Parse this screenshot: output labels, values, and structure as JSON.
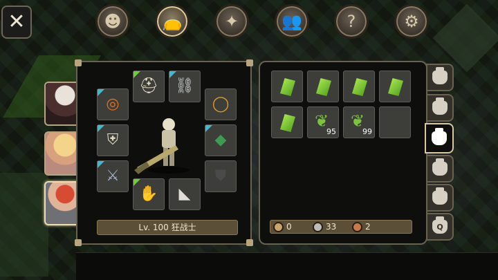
{
  "close_button": {
    "label": "✕",
    "icon": "close-icon"
  },
  "top_tabs": [
    {
      "icon": "profile-head-icon",
      "glyph": "☻",
      "active": false
    },
    {
      "icon": "bag-icon",
      "glyph": "👝",
      "active": true
    },
    {
      "icon": "skill-compass-icon",
      "glyph": "✦",
      "active": false
    },
    {
      "icon": "party-icon",
      "glyph": "👥",
      "active": false
    },
    {
      "icon": "quest-scroll-icon",
      "glyph": "?",
      "active": false
    },
    {
      "icon": "gear-icon",
      "glyph": "⚙",
      "active": false
    }
  ],
  "characters": [
    {
      "name": "white-hair-character",
      "active": false
    },
    {
      "name": "blonde-character",
      "active": false
    },
    {
      "name": "red-hair-armored-character",
      "active": true
    }
  ],
  "equipment": {
    "level_text": "Lv. 100 狂战士",
    "slots": [
      {
        "name": "necklace-slot",
        "icon": "necklace-icon",
        "glyph": "⛓",
        "rarity": "blue",
        "color": "#cfd4d6"
      },
      {
        "name": "helmet-slot",
        "icon": "helmet-icon",
        "glyph": "⛑",
        "rarity": "green",
        "color": "#e8e2c6"
      },
      {
        "name": "ring-slot-left",
        "icon": "ring-icon",
        "glyph": "◎",
        "rarity": "blue",
        "color": "#e07020"
      },
      {
        "name": "ring-slot-right",
        "icon": "ring-icon",
        "glyph": "◯",
        "rarity": "none",
        "color": "#e39a2a"
      },
      {
        "name": "armor-slot",
        "icon": "armor-icon",
        "glyph": "⛨",
        "rarity": "blue",
        "color": "#ded8bf"
      },
      {
        "name": "cape-slot",
        "icon": "cape-icon",
        "glyph": "◆",
        "rarity": "blue",
        "color": "#3f9a52"
      },
      {
        "name": "weapon-slot",
        "icon": "sword-icon",
        "glyph": "⚔",
        "rarity": "blue",
        "color": "#a6b0c8"
      },
      {
        "name": "shield-slot",
        "icon": "shield-icon",
        "glyph": "⛊",
        "rarity": "none",
        "color": "#3a3a3a"
      },
      {
        "name": "gloves-slot",
        "icon": "gloves-icon",
        "glyph": "✋",
        "rarity": "green",
        "color": "#b06a40"
      },
      {
        "name": "boots-slot",
        "icon": "boots-icon",
        "glyph": "◣",
        "rarity": "none",
        "color": "#e0dcd6"
      }
    ]
  },
  "inventory": {
    "items": [
      {
        "type": "gem",
        "icon": "green-gem-icon",
        "qty": ""
      },
      {
        "type": "gem",
        "icon": "green-gem-icon",
        "qty": ""
      },
      {
        "type": "gem",
        "icon": "green-gem-icon",
        "qty": ""
      },
      {
        "type": "gem",
        "icon": "green-gem-icon",
        "qty": ""
      },
      {
        "type": "gem",
        "icon": "green-gem-icon",
        "qty": ""
      },
      {
        "type": "herb",
        "icon": "herb-leaf-icon",
        "qty": "95"
      },
      {
        "type": "herb",
        "icon": "herb-leaf-icon",
        "qty": "99"
      },
      {
        "type": "empty",
        "icon": "",
        "qty": ""
      }
    ],
    "currency": [
      {
        "icon": "gold-coin-icon",
        "value": "0"
      },
      {
        "icon": "silver-coin-icon",
        "value": "33"
      },
      {
        "icon": "copper-coin-icon",
        "value": "2"
      }
    ]
  },
  "bag_tabs": [
    {
      "icon": "bag-icon",
      "label": "",
      "active": false
    },
    {
      "icon": "bag-icon",
      "label": "",
      "active": false
    },
    {
      "icon": "bag-icon",
      "label": "",
      "active": true
    },
    {
      "icon": "bag-icon",
      "label": "",
      "active": false
    },
    {
      "icon": "bag-icon",
      "label": "",
      "active": false
    },
    {
      "icon": "quest-bag-icon",
      "label": "Q",
      "active": false
    }
  ]
}
